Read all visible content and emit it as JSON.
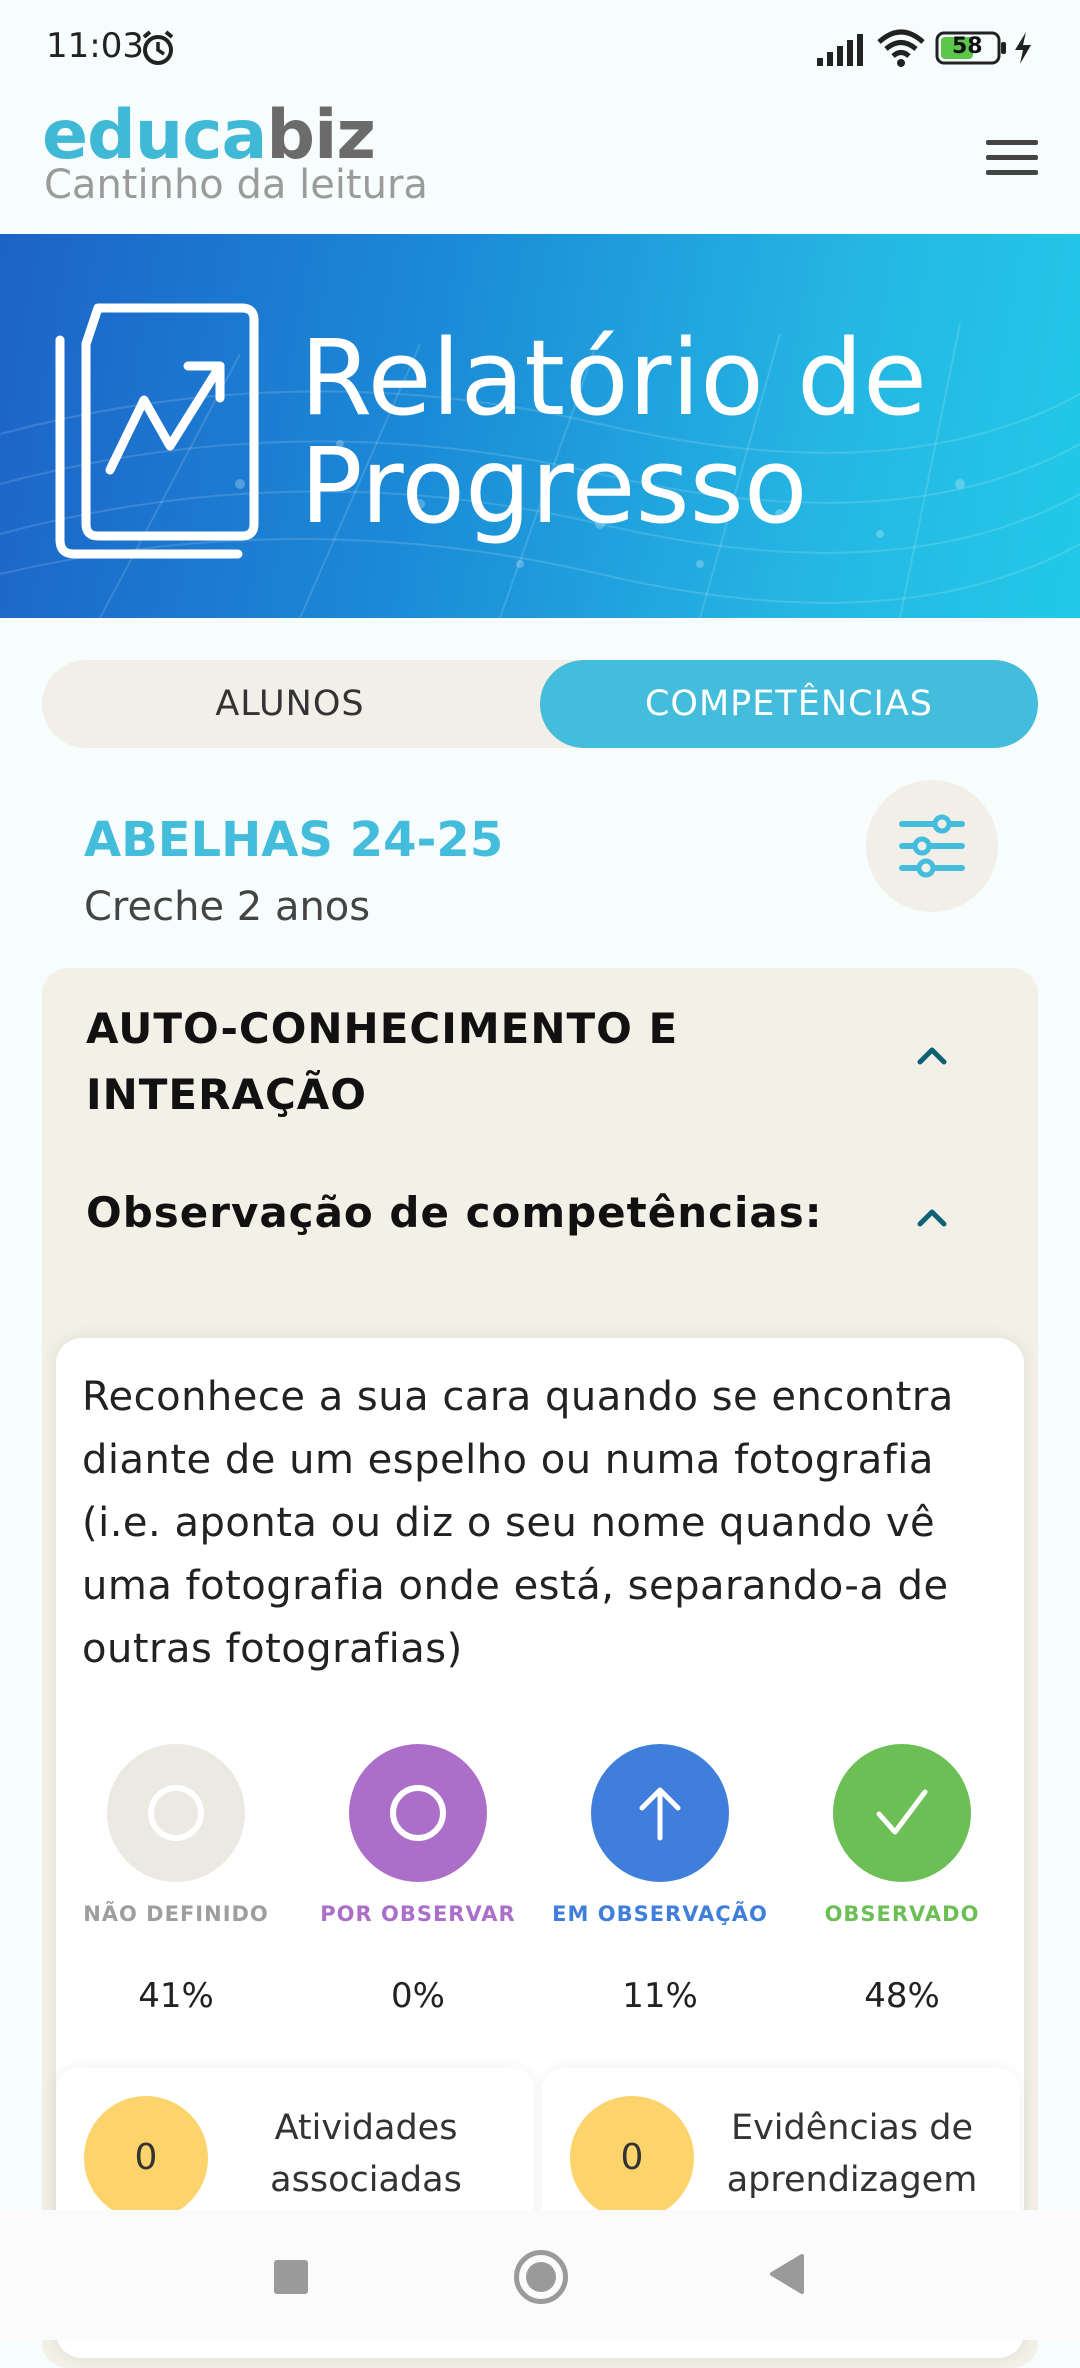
{
  "statusbar": {
    "time": "11:03",
    "battery": "58"
  },
  "header": {
    "logo_part1": "educa",
    "logo_part2": "biz",
    "subtitle": "Cantinho da leitura"
  },
  "banner": {
    "title_line1": "Relatório de",
    "title_line2": "Progresso"
  },
  "tabs": [
    {
      "label": "ALUNOS",
      "active": false
    },
    {
      "label": "COMPETÊNCIAS",
      "active": true
    }
  ],
  "group": {
    "name": "ABELHAS 24-25",
    "class": "Creche 2 anos"
  },
  "section": {
    "title": "AUTO-CONHECIMENTO E INTERAÇÃO",
    "observation_title": "Observação de competências:"
  },
  "competency": {
    "text": "Reconhece a sua cara quando se encontra diante de um espelho ou numa fotografia (i.e. aponta ou diz o seu nome quando vê uma fotografia onde está, separando-a de outras fotografias)",
    "statuses": [
      {
        "label": "NÃO DEFINIDO",
        "percent": "41%",
        "color": "#ece8e2",
        "label_color": "#9e9e9e",
        "icon": "circle-outline-icon"
      },
      {
        "label": "POR OBSERVAR",
        "percent": "0%",
        "color": "#ab6fc9",
        "label_color": "#ab6fc9",
        "icon": "circle-outline-icon"
      },
      {
        "label": "EM OBSERVAÇÃO",
        "percent": "11%",
        "color": "#3f7fdb",
        "label_color": "#3f7fdb",
        "icon": "arrow-up-icon"
      },
      {
        "label": "OBSERVADO",
        "percent": "48%",
        "color": "#6cbf55",
        "label_color": "#6cbf55",
        "icon": "check-icon"
      }
    ],
    "activities": {
      "count": "0",
      "label": "Atividades associadas"
    },
    "evidences": {
      "count": "0",
      "label": "Evidências de aprendizagem"
    }
  },
  "colors": {
    "accent": "#43bddb",
    "badge": "#fdd36b",
    "section_bg": "#f3f0e8"
  }
}
